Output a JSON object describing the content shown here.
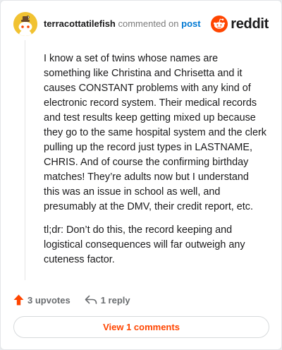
{
  "header": {
    "author": "terracottatilefish",
    "action_text": "commented on",
    "link_text": "post",
    "brand": "reddit",
    "avatar_icon": "snoo-avatar-icon"
  },
  "comment": {
    "paragraphs": [
      "I know a set of twins whose names are something like Christina and Chrisetta and it causes CONSTANT problems with any kind of electronic record system. Their medical records and test results keep getting mixed up because they go to the same hospital system and the clerk pulling up the record just types in LASTNAME, CHRIS. And of course the confirming birthday matches! They’re adults now but I understand this was an issue in school as well, and presumably at the DMV, their credit report, etc.",
      "tl;dr: Don’t do this, the record keeping and logistical consequences will far outweigh any cuteness factor."
    ]
  },
  "actions": {
    "upvotes": "3 upvotes",
    "replies": "1 reply"
  },
  "footer": {
    "view_button": "View 1 comments"
  },
  "colors": {
    "accent": "#ff4500",
    "link": "#0079d3",
    "avatar_bg": "#f1c232"
  }
}
